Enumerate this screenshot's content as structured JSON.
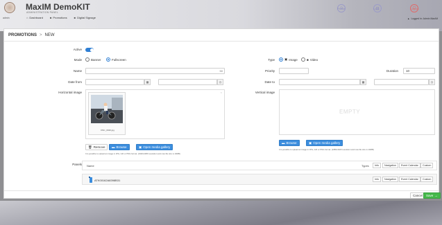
{
  "header": {
    "app_title": "MaxIM DemoKIT",
    "app_subtitle": "ADMINISTRATION PANEL",
    "user_caption": "admin",
    "nav": [
      {
        "icon": "home-icon",
        "label": "Dashboard"
      },
      {
        "icon": "grid-icon",
        "label": "Promotions"
      },
      {
        "icon": "grid-icon",
        "label": "Digital Signage"
      }
    ],
    "profile_label": "Profile",
    "lock_label": "Lock",
    "logout_label": "Logout",
    "logged_in_text": "Logged in: Admin MaxIM"
  },
  "breadcrumb": {
    "section": "PROMOTIONS",
    "separator": ">",
    "page": "NEW"
  },
  "form": {
    "active_label": "Active",
    "active": true,
    "mode_label": "Mode",
    "mode_options": [
      "Banner",
      "Fullscreen"
    ],
    "mode_selected": "Fullscreen",
    "name_label": "Name",
    "name_value": "",
    "name_counter": "50",
    "date_from_label": "Date from",
    "date_from_value": "",
    "time_from_value": "",
    "horizontal_image_label": "Horizontal image",
    "horizontal_image_file": "DSC_0020.jpg",
    "remove_label": "Remove",
    "browse_label": "Browse",
    "open_gallery_label": "Open media gallery",
    "horizontal_hint": "It is possible to upload an image in JPG, GIF or PNG format. (1920x1080 resolution and max file size is 10MB)",
    "type_label": "Type",
    "type_options": [
      "Image",
      "Video"
    ],
    "type_selected": "Image",
    "priority_label": "Priority",
    "priority_value": "",
    "duration_label": "Duration",
    "duration_value": "10",
    "date_to_label": "Date to",
    "date_to_value": "",
    "time_to_value": "",
    "vertical_image_label": "Vertical image",
    "vertical_empty_text": "EMPTY",
    "vertical_hint": "It is possible to upload an image in JPG, GIF or PNG format. (1080x1920 resolution and max file size is 10MB)",
    "panels_label": "Panels",
    "panels_table": {
      "name_header": "Name",
      "types_header": "Types",
      "type_chips": [
        "Info",
        "Navigation",
        "Event Calendar",
        "Custom"
      ],
      "rows": [
        {
          "name": "ATK00162A8398B31",
          "chips": [
            "Info",
            "Navigation",
            "Event Calendar",
            "Custom"
          ]
        }
      ]
    }
  },
  "footer": {
    "cancel_label": "Cancel",
    "save_label": "Save"
  },
  "colors": {
    "accent": "#3b8dde",
    "success": "#44b84a",
    "logout": "#e06a6a"
  }
}
